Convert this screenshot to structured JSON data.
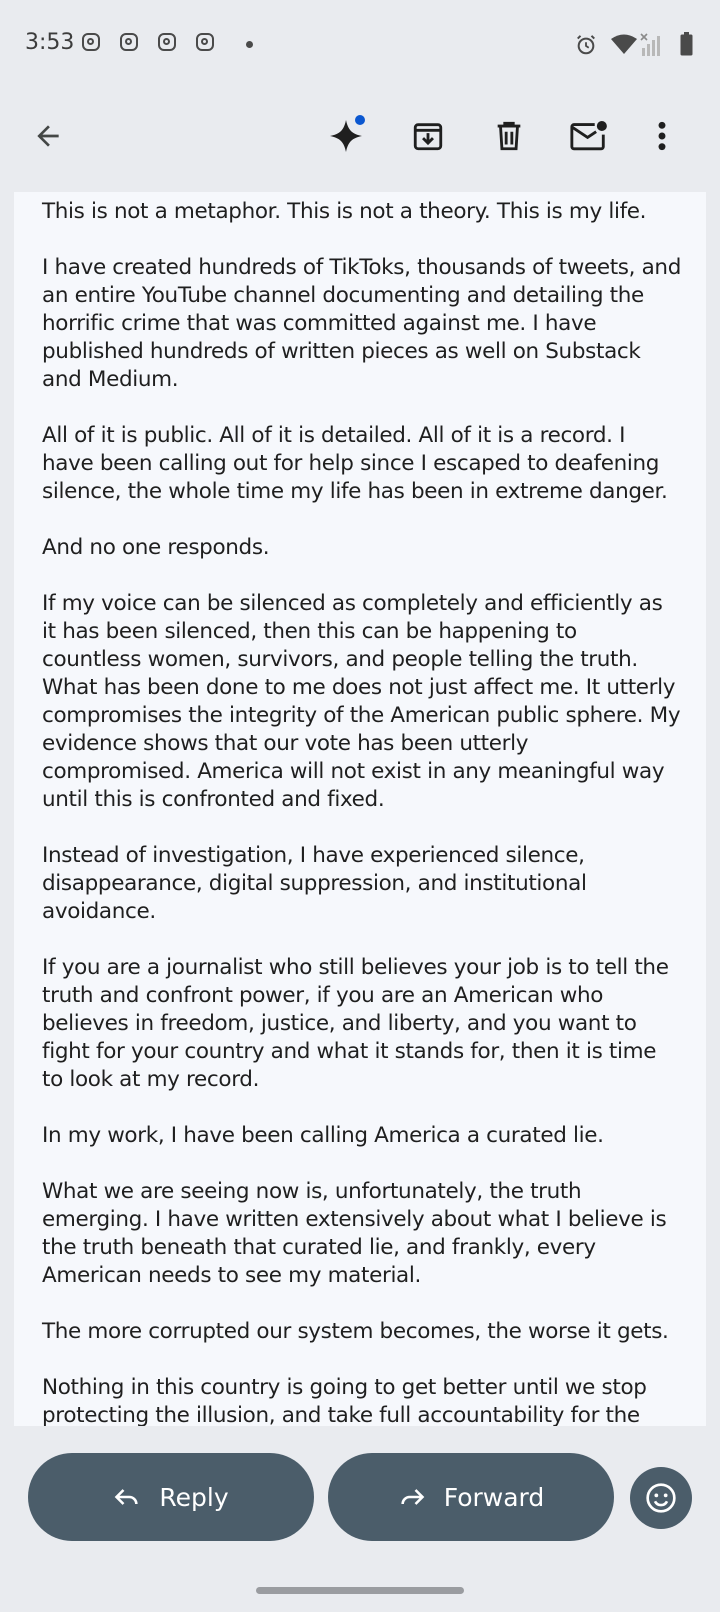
{
  "status_bar": {
    "time": "3:53",
    "notification_icons": [
      "instagram-icon",
      "instagram-icon",
      "instagram-icon",
      "instagram-icon"
    ],
    "right_icons": [
      "alarm-icon",
      "wifi-icon",
      "signal-icon",
      "battery-icon"
    ]
  },
  "toolbar": {
    "back_icon": "arrow-back-icon",
    "actions": [
      "gemini-sparkle-icon",
      "archive-icon",
      "delete-icon",
      "mark-unread-icon",
      "more-vert-icon"
    ],
    "accent_color": "#0b57d0"
  },
  "email": {
    "paragraphs": [
      "This is not a metaphor. This is not a theory. This is my life.",
      "I have created hundreds of TikToks, thousands of tweets, and an entire YouTube channel documenting and detailing the horrific crime that was committed against me. I have published hundreds of written pieces as well on Substack and Medium.",
      "All of it is public. All of it is detailed. All of it is a record. I have been calling out for help since I escaped to deafening silence, the whole time my life has been in extreme danger.",
      "And no one responds.",
      "If my voice can be silenced as completely and efficiently as it has been silenced, then this can be happening to countless women, survivors, and people telling the truth. What has been done to me does not just affect me. It utterly compromises the integrity of the American public sphere. My evidence shows that our vote has been utterly compromised. America will not exist in any meaningful way until this is confronted and fixed.",
      "Instead of investigation, I have experienced silence, disappearance, digital suppression, and institutional avoidance.",
      "If you are a journalist who still believes your job is to tell the truth and confront power, if you are an American who believes in freedom, justice, and liberty, and you want to fight for your country and what it stands for, then it is time to look at my record.",
      "In my work, I have been calling America a curated lie.",
      "What we are seeing now is, unfortunately, the truth emerging. I have written extensively about what I believe is the truth beneath that curated lie, and frankly, every American needs to see my material.",
      "The more corrupted our system becomes, the worse it gets.",
      "Nothing in this country is going to get better until we stop protecting the illusion, and take full accountability for the"
    ]
  },
  "actions": {
    "reply_label": "Reply",
    "forward_label": "Forward",
    "button_color": "#4b5d6a"
  }
}
